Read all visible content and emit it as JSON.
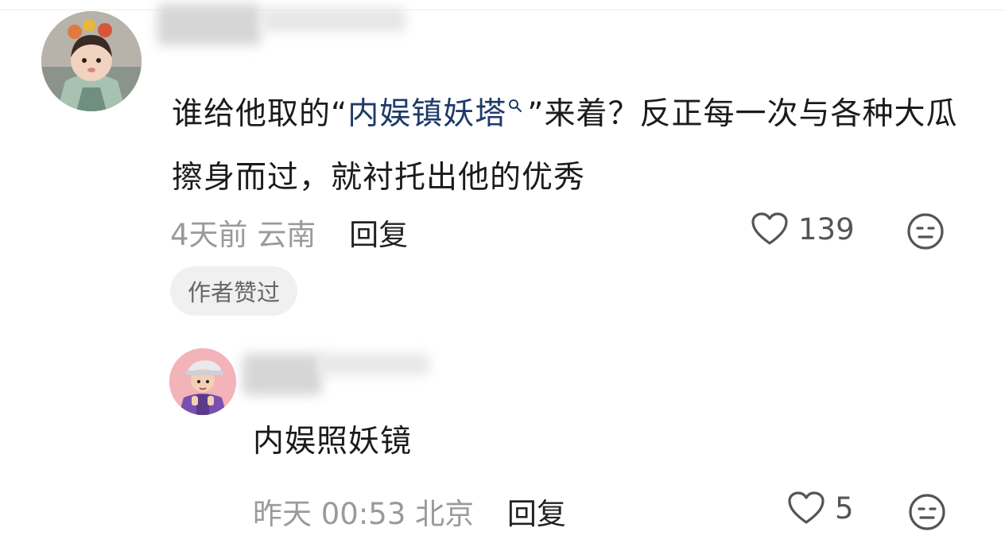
{
  "comments": [
    {
      "text_before": "谁给他取的“",
      "highlight": "内娱镇妖塔",
      "text_after": "”来着？反正每一次与各种大瓜擦身而过，就衬托出他的优秀",
      "time": "4天前",
      "location": "云南",
      "reply_label": "回复",
      "likes": "139",
      "badge": "作者赞过"
    }
  ],
  "reply": {
    "text": "内娱照妖镜",
    "time": "昨天 00:53",
    "location": "北京",
    "reply_label": "回复",
    "likes": "5"
  },
  "icons": {
    "search": "search-icon",
    "like": "heart-outline-icon",
    "emoji": "neutral-face-icon"
  },
  "colors": {
    "highlight": "#1e3a68",
    "meta": "#9a9a9a",
    "badge_bg": "#f0f0f0"
  }
}
